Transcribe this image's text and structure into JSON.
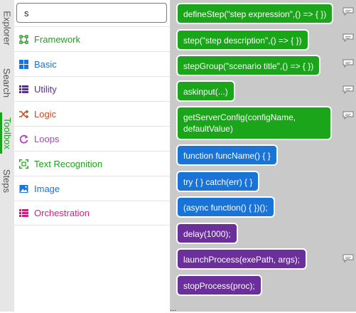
{
  "tabs": [
    {
      "label": "Explorer"
    },
    {
      "label": "Search"
    },
    {
      "label": "Toolbox"
    },
    {
      "label": "Steps"
    }
  ],
  "search": {
    "value": "s"
  },
  "categories": [
    {
      "label": "Framework",
      "icon": "framework-icon",
      "color": "#1aa51a"
    },
    {
      "label": "Basic",
      "icon": "basic-icon",
      "color": "#1a73d6"
    },
    {
      "label": "Utility",
      "icon": "utility-icon",
      "color": "#5b2f8f"
    },
    {
      "label": "Logic",
      "icon": "logic-icon",
      "color": "#c94a1c"
    },
    {
      "label": "Loops",
      "icon": "loops-icon",
      "color": "#b43bc0"
    },
    {
      "label": "Text Recognition",
      "icon": "text-recognition-icon",
      "color": "#1aa51a"
    },
    {
      "label": "Image",
      "icon": "image-icon",
      "color": "#1a73d6"
    },
    {
      "label": "Orchestration",
      "icon": "orchestration-icon",
      "color": "#d41c80"
    }
  ],
  "blocks": [
    {
      "text": "defineStep(\"step expression\",() => { })",
      "color": "green"
    },
    {
      "text": "step(\"step description\",() => { })",
      "color": "green"
    },
    {
      "text": "stepGroup(\"scenario title\",() => { })",
      "color": "green"
    },
    {
      "text": "askinput(...)",
      "color": "green"
    },
    {
      "text": "getServerConfig(configName, defaultValue)",
      "color": "green"
    },
    {
      "text": "function funcName() { }",
      "color": "blue"
    },
    {
      "text": "try { } catch(err) { }",
      "color": "blue"
    },
    {
      "text": "(async function() { })();",
      "color": "blue"
    },
    {
      "text": "delay(1000);",
      "color": "purple"
    },
    {
      "text": "launchProcess(exePath, args);",
      "color": "purple"
    },
    {
      "text": "stopProcess(proc);",
      "color": "purple"
    }
  ],
  "workspace": {
    "overflow_text": "..."
  },
  "colors": {
    "green": "#1aa51a",
    "blue": "#1a73d6",
    "purple": "#6b2f9c",
    "workspace_bg": "#c9c9c9"
  }
}
